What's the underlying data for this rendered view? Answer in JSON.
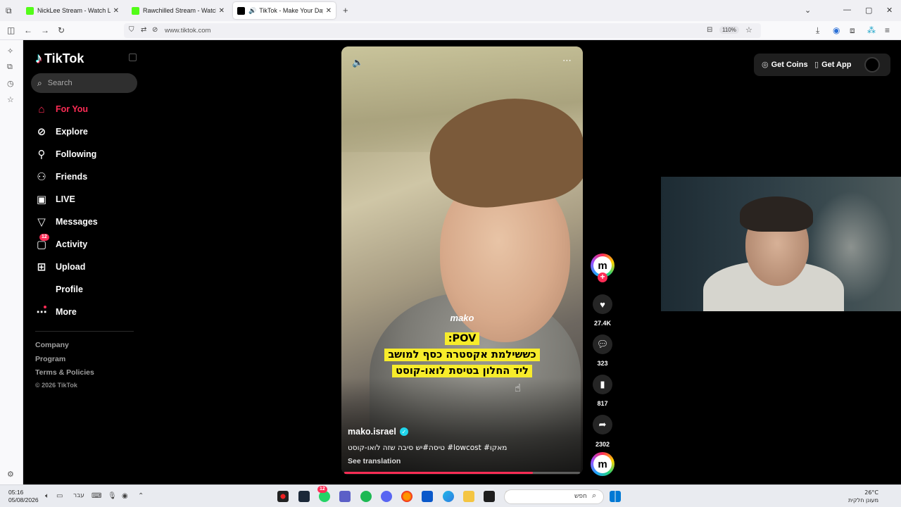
{
  "browser": {
    "tabs": [
      {
        "title": "NickLee Stream - Watch Live on",
        "favicon_color": "#53fc18"
      },
      {
        "title": "Rawchilled Stream - Watch Live",
        "favicon_color": "#53fc18"
      },
      {
        "title": "TikTok - Make Your Day",
        "favicon_color": "#000000",
        "active": true,
        "audio": "🔊"
      }
    ],
    "new_tab_icon": "+",
    "url": "www.tiktok.com",
    "zoom": "110%"
  },
  "tiktok": {
    "logo_text": "TikTok",
    "search_placeholder": "Search",
    "nav": [
      {
        "label": "For You",
        "icon": "home-icon",
        "active": true
      },
      {
        "label": "Explore",
        "icon": "compass-icon"
      },
      {
        "label": "Following",
        "icon": "following-icon"
      },
      {
        "label": "Friends",
        "icon": "friends-icon"
      },
      {
        "label": "LIVE",
        "icon": "live-icon"
      },
      {
        "label": "Messages",
        "icon": "send-icon"
      },
      {
        "label": "Activity",
        "icon": "activity-icon",
        "badge": "12"
      },
      {
        "label": "Upload",
        "icon": "upload-icon"
      },
      {
        "label": "Profile",
        "icon": "profile-icon"
      },
      {
        "label": "More",
        "icon": "more-icon"
      }
    ],
    "footer": [
      "Company",
      "Program",
      "Terms & Policies"
    ],
    "copyright": "© 2026 TikTok",
    "top_right": {
      "coins": "Get Coins",
      "app": "Get App"
    }
  },
  "video": {
    "watermark": "mako",
    "caption_lines": [
      ":POV",
      "כששילמת אקסטרה כסף למושב",
      "ליד החלון בטיסת לואו-קוסט"
    ],
    "author": "mako.israel",
    "description": "מאקו# lowcost# טיסה#יש סיבה שזה לואו-קוסט",
    "see_translation": "See translation",
    "progress": 0.8,
    "creator_avatar_letter": "m",
    "actions": {
      "likes": "27.4K",
      "comments": "323",
      "saves": "817",
      "shares": "2302"
    }
  },
  "taskbar": {
    "time": "05:16",
    "date": "05/08/2026",
    "language": "עבר",
    "search_text": "חפש",
    "badge": "12",
    "temperature": "26°C",
    "weather_text": "מעונן חלקית"
  }
}
